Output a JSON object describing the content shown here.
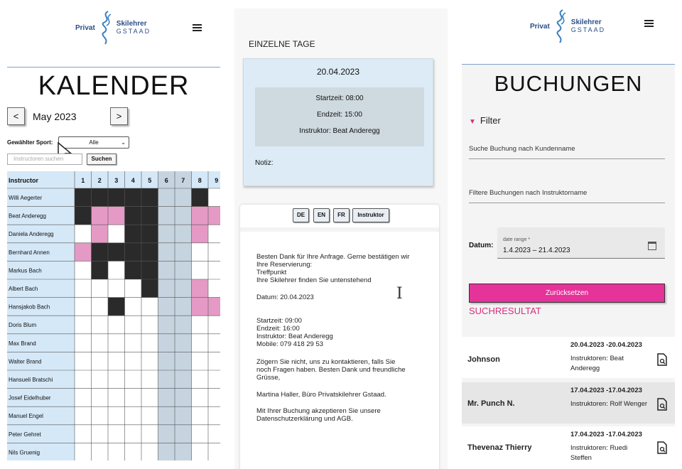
{
  "brand": {
    "word1": "Privat",
    "word2": "Skilehrer",
    "word3": "GSTAAD"
  },
  "calendar_panel": {
    "title": "KALENDER",
    "prev_label": "<",
    "next_label": ">",
    "month": "May 2023",
    "sport_label": "Gewählter Sport:",
    "sport_value": "Alle",
    "instructor_placeholder": "Instructoren suchen",
    "search_label": "Suchen",
    "column_header": "Instructor",
    "days": [
      "1",
      "2",
      "3",
      "4",
      "5",
      "6",
      "7",
      "8",
      "9"
    ],
    "instructors": [
      "Willi Aegerter",
      "Beat Anderegg",
      "Daniela Anderegg",
      "Bernhard Annen",
      "Markus Bach",
      "Albert Bach",
      "Hansjakob Bach",
      "Doris Blum",
      "Max Brand",
      "Walter Brand",
      "Hansueli Bratschi",
      "Josef Eidelhuber",
      "Manuel Engel",
      "Peter Gehret",
      "Nils Gruenig"
    ],
    "colors": {
      "booked": "#2a2a2a",
      "pink": "#e59ac5",
      "blue": "#d5e8f7",
      "weekend": "#c6d4e0"
    }
  },
  "days_panel": {
    "section_title": "EINZELNE TAGE",
    "card": {
      "date": "20.04.2023",
      "start": "Startzeit: 08:00",
      "end": "Endzeit: 15:00",
      "instructor": "Instruktor: Beat Anderegg",
      "note": "Notiz:"
    },
    "languages": [
      "DE",
      "EN",
      "FR",
      "Instruktor"
    ],
    "email": {
      "intro": [
        "Besten Dank für Ihre Anfrage. Gerne bestätigen wir",
        "Ihre Reservierung:",
        "Treffpunkt",
        "Ihre Skilehrer finden Sie untenstehend"
      ],
      "date": "Datum: 20.04.2023",
      "details": [
        "Startzeit: 09:00",
        "Endzeit: 16:00",
        "Instruktor: Beat Anderegg",
        "Mobile: 079 418 29 53"
      ],
      "closing": [
        "Zögern Sie nicht, uns zu kontaktieren, falls Sie",
        "noch Fragen haben. Besten Dank und freundliche",
        "Grüsse,"
      ],
      "signature": "Martina Haller, Büro Privatskilehrer Gstaad.",
      "footer": [
        "Mit Ihrer Buchung akzeptieren Sie unsere",
        "Datenschutzerklärung und AGB."
      ]
    }
  },
  "bookings_panel": {
    "title": "BUCHUNGEN",
    "filter_label": "Filter",
    "customer_search": "Suche Buchung nach Kundenname",
    "instructor_filter": "Filtere Buchungen nach Instruktorname",
    "date_label": "Datum:",
    "date_range_label": "date range *",
    "date_range_value": "1.4.2023 – 21.4.2023",
    "reset_label": "Zurücksetzen",
    "results_title": "SUCHRESULTAT",
    "results": [
      {
        "name": "Johnson",
        "dates": "20.04.2023 -20.04.2023",
        "instructors": [
          "Instruktoren: Beat",
          "Anderegg"
        ]
      },
      {
        "name": "Mr. Punch N.",
        "dates": "17.04.2023 -17.04.2023",
        "instructors": [
          "Instruktoren: Rolf Wenger"
        ]
      },
      {
        "name": "Thevenaz Thierry",
        "dates": "17.04.2023 -17.04.2023",
        "instructors": [
          "Instruktoren: Ruedi",
          "Steffen"
        ]
      }
    ],
    "accent": "#e5339a"
  }
}
